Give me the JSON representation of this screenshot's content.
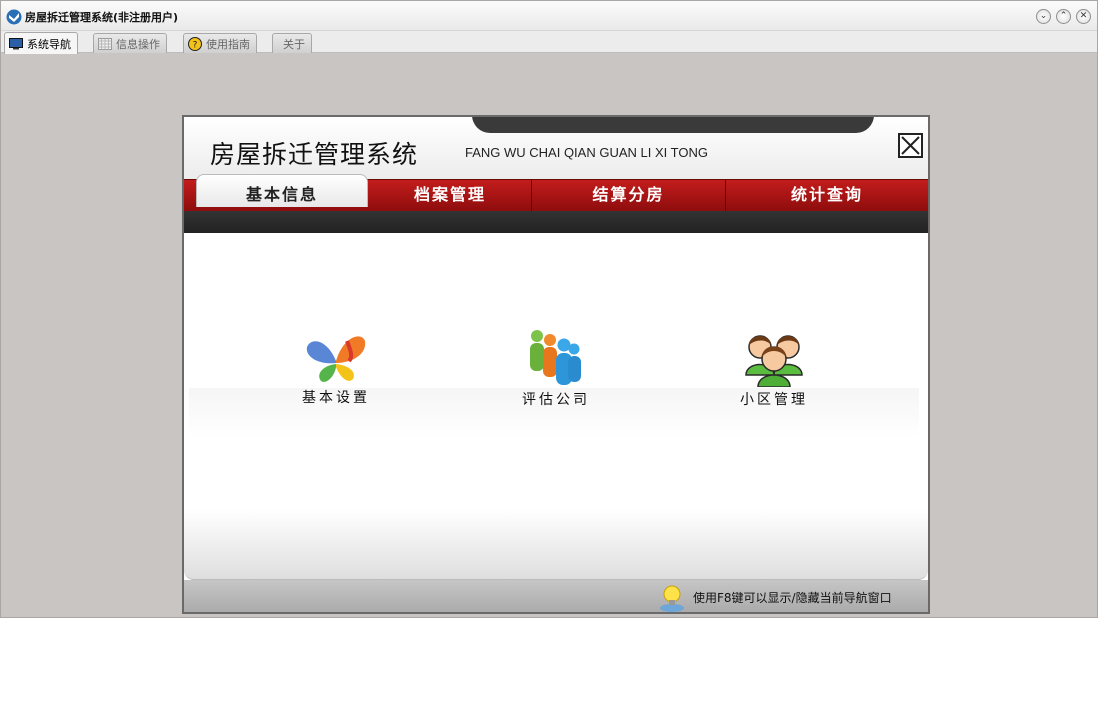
{
  "window": {
    "title": "房屋拆迁管理系统(非注册用户)",
    "controls": [
      "minimize",
      "maximize",
      "close"
    ]
  },
  "tabs": [
    {
      "label": "系统导航",
      "icon": "monitor-icon",
      "active": true
    },
    {
      "label": "信息操作",
      "icon": "grid-icon",
      "active": false
    },
    {
      "label": "使用指南",
      "icon": "help-icon",
      "active": false
    },
    {
      "label": "关于",
      "icon": "",
      "active": false
    }
  ],
  "panel": {
    "title": "房屋拆迁管理系统",
    "pinyin": "FANG WU CHAI QIAN GUAN LI XI TONG",
    "nav": [
      {
        "label": "基本信息",
        "active": true
      },
      {
        "label": "档案管理",
        "active": false
      },
      {
        "label": "结算分房",
        "active": false
      },
      {
        "label": "统计查询",
        "active": false
      }
    ],
    "modules": [
      {
        "label": "基本设置",
        "icon": "butterfly-icon"
      },
      {
        "label": "评估公司",
        "icon": "people-group-icon"
      },
      {
        "label": "小区管理",
        "icon": "users-icon"
      }
    ],
    "footer_hint": "使用F8键可以显示/隐藏当前导航窗口"
  },
  "colors": {
    "nav_red": "#b01414",
    "window_bg": "#c9c5c2"
  }
}
